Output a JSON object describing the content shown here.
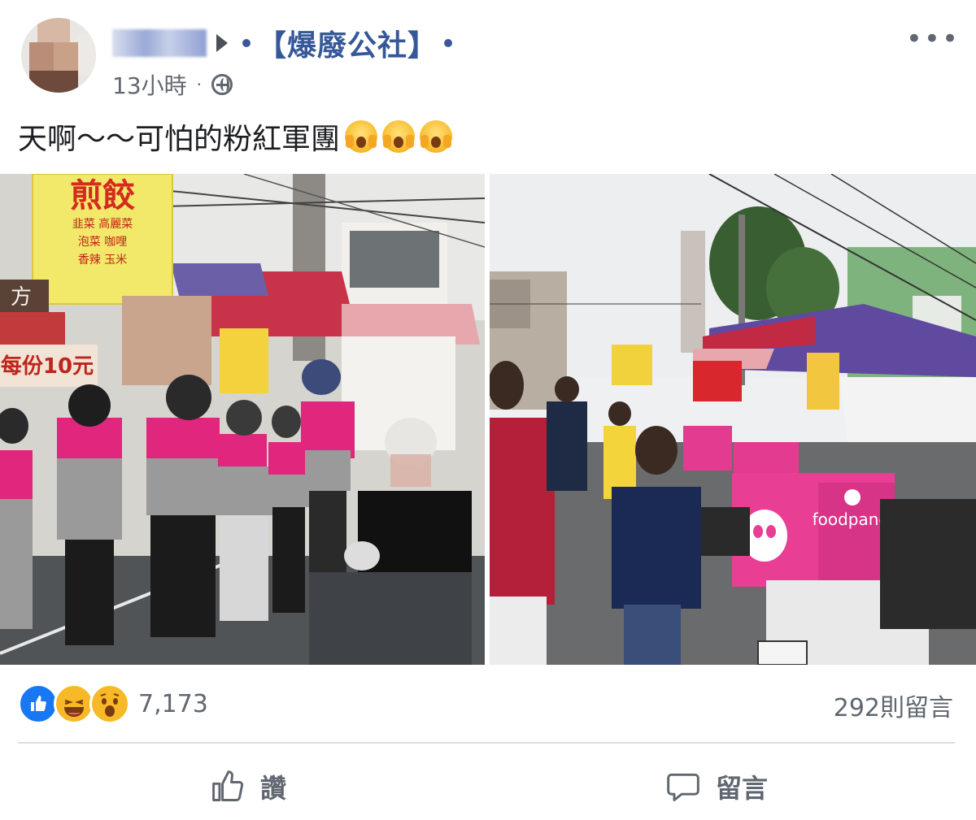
{
  "post": {
    "group_name": "【爆廢公社】",
    "time": "13小時",
    "separator": "·",
    "text": "天啊～～可怕的粉紅軍團",
    "emojis": [
      "screaming-face-emoji",
      "screaming-face-emoji",
      "screaming-face-emoji"
    ]
  },
  "photos": {
    "left": {
      "signs": [
        "煎餃",
        "每份10元",
        "方"
      ],
      "sign_lines": [
        "韭菜",
        "高麗菜",
        "泡菜",
        "咖哩",
        "香辣",
        "玉米"
      ]
    },
    "right": {
      "box_label": "foodpanda"
    }
  },
  "reactions": {
    "types": [
      "like-icon",
      "haha-icon",
      "wow-icon"
    ],
    "count": "7,173",
    "comments": "292則留言"
  },
  "actions": {
    "like_label": "讚",
    "comment_label": "留言"
  },
  "colors": {
    "group_link": "#365899",
    "meta_text": "#606770",
    "like_blue": "#1877f2",
    "panda_pink": "#e0267d"
  }
}
